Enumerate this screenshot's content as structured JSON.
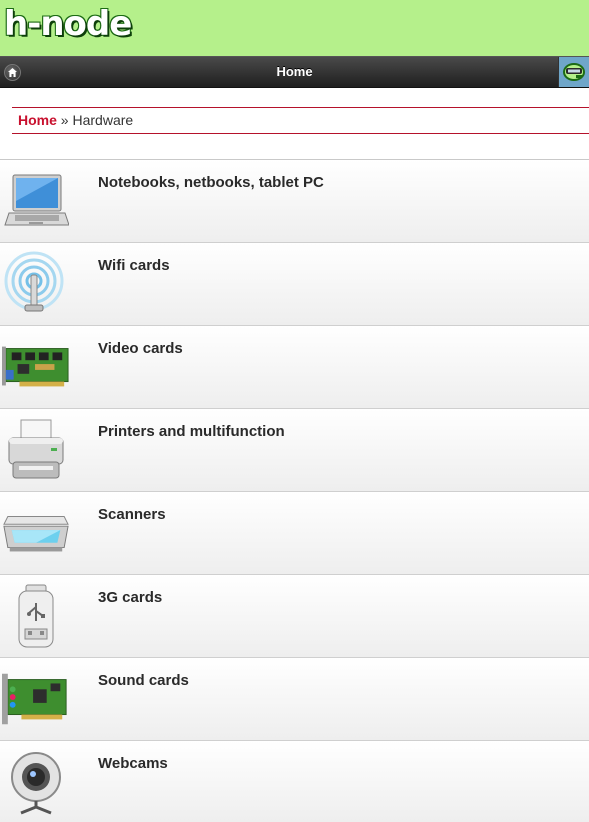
{
  "header": {
    "logo_text": "h-node"
  },
  "toolbar": {
    "title": "Home",
    "home_icon": "home-icon",
    "mobile_icon": "mobile-site-icon"
  },
  "breadcrumb": {
    "home": "Home",
    "separator": "»",
    "current": "Hardware"
  },
  "categories": [
    {
      "label": "Notebooks, netbooks, tablet PC",
      "icon": "laptop-icon"
    },
    {
      "label": "Wifi cards",
      "icon": "wifi-antenna-icon"
    },
    {
      "label": "Video cards",
      "icon": "video-card-icon"
    },
    {
      "label": "Printers and multifunction",
      "icon": "printer-icon"
    },
    {
      "label": "Scanners",
      "icon": "scanner-icon"
    },
    {
      "label": "3G cards",
      "icon": "usb-modem-icon"
    },
    {
      "label": "Sound cards",
      "icon": "sound-card-icon"
    },
    {
      "label": "Webcams",
      "icon": "webcam-icon"
    }
  ],
  "colors": {
    "header_bg": "#b5f08b",
    "breadcrumb_accent": "#b5122b",
    "home_link": "#c8102e",
    "toolbar_bg": "#2b2b2b"
  }
}
